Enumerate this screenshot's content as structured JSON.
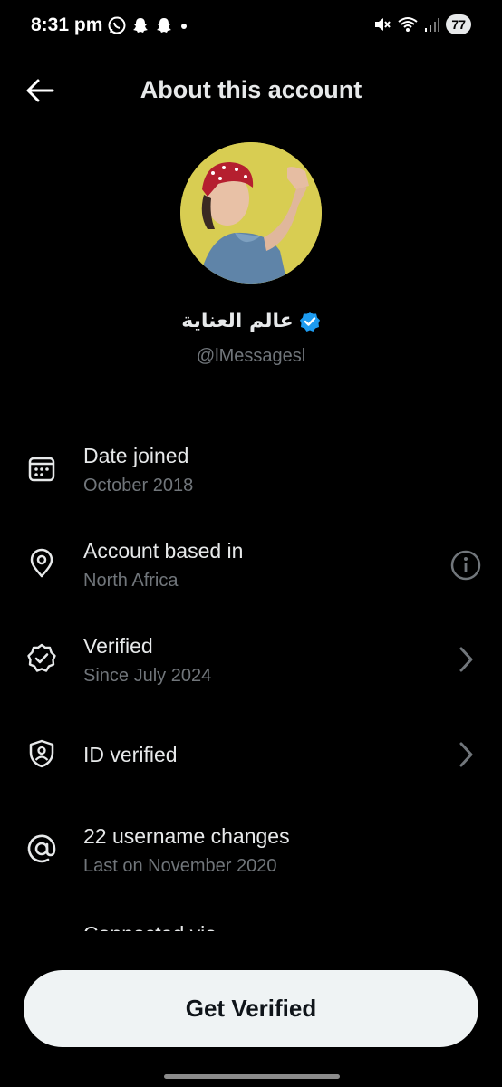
{
  "status_bar": {
    "time": "8:31 pm",
    "battery": "77"
  },
  "header": {
    "title": "About this account"
  },
  "profile": {
    "display_name": "عالم العناية",
    "handle": "@lMessagesl"
  },
  "rows": [
    {
      "icon": "calendar-icon",
      "title": "Date joined",
      "subtitle": "October 2018"
    },
    {
      "icon": "location-pin-icon",
      "title": "Account based in",
      "subtitle": "North Africa",
      "right_icon": "info-icon"
    },
    {
      "icon": "verified-badge-icon",
      "title": "Verified",
      "subtitle": "Since July 2024",
      "right_icon": "chevron-right-icon"
    },
    {
      "icon": "id-shield-icon",
      "title": "ID verified",
      "right_icon": "chevron-right-icon"
    },
    {
      "icon": "at-sign-icon",
      "title": "22 username changes",
      "subtitle": "Last on November 2020"
    }
  ],
  "partial_row": {
    "title": "Connected via"
  },
  "cta": {
    "label": "Get Verified"
  },
  "colors": {
    "background": "#000000",
    "primary_text": "#e7e9ea",
    "secondary_text": "#71767b",
    "verified_blue": "#1d9bf0",
    "button_bg": "#eff3f4"
  }
}
